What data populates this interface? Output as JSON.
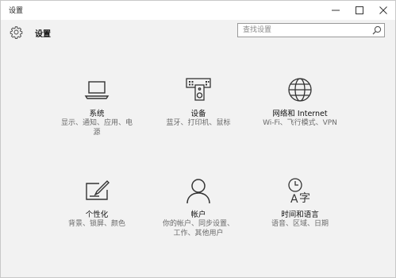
{
  "window": {
    "title": "设置",
    "controls": [
      "minimize-icon",
      "maximize-icon",
      "close-icon"
    ]
  },
  "header": {
    "title": "设置",
    "icon": "gear-icon",
    "search": {
      "placeholder": "查找设置",
      "value": "",
      "icon": "search-icon"
    }
  },
  "tiles": [
    {
      "icon": "laptop-icon",
      "label": "系统",
      "desc": [
        "显示、通知、应用、电",
        "源"
      ]
    },
    {
      "icon": "devices-icon",
      "label": "设备",
      "desc": [
        "蓝牙、打印机、鼠标"
      ]
    },
    {
      "icon": "globe-icon",
      "label": "网络和 Internet",
      "desc": [
        "Wi-Fi、飞行模式、VPN"
      ]
    },
    {
      "icon": "personalize-icon",
      "label": "个性化",
      "desc": [
        "背景、锁屏、颜色"
      ]
    },
    {
      "icon": "account-icon",
      "label": "帐户",
      "desc": [
        "你的帐户、同步设置、",
        "工作、其他用户"
      ]
    },
    {
      "icon": "time-language-icon",
      "label": "时间和语言",
      "desc": [
        "语音、区域、日期"
      ]
    }
  ]
}
